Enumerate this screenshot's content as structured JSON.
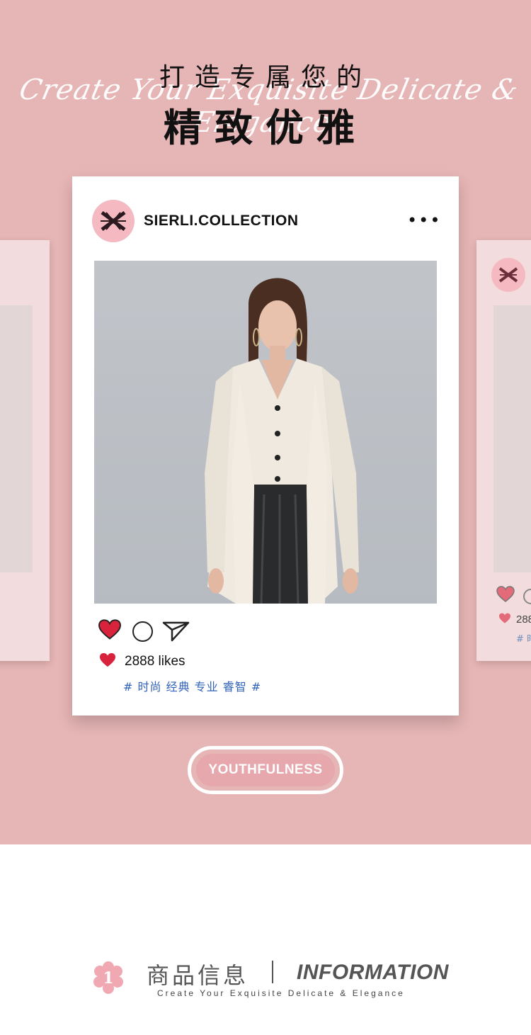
{
  "header": {
    "line1": "打造专属您的",
    "script": "Create Your Exquisite Delicate & Elegance",
    "line2": "精致优雅"
  },
  "post": {
    "handle": "SIERLI.COLLECTION",
    "more_icon": "•••",
    "likes": "2888 likes",
    "tags": "# 时尚 经典 专业 睿智 #",
    "icons": [
      "heart-icon",
      "comment-icon",
      "share-icon",
      "more-icon"
    ]
  },
  "side_right": {
    "likes": "288",
    "tags": "# 时"
  },
  "badge": {
    "label": "YOUTHFULNESS"
  },
  "section": {
    "number": "1",
    "title_cn": "商品信息",
    "title_en": "INFORMATION",
    "subtitle": "Create Your Exquisite Delicate & Elegance"
  },
  "colors": {
    "hero_bg": "#e6b5b5",
    "heart_red": "#d9233c",
    "tag_blue": "#2f62b8",
    "avatar_pink": "#f5b9c1"
  }
}
